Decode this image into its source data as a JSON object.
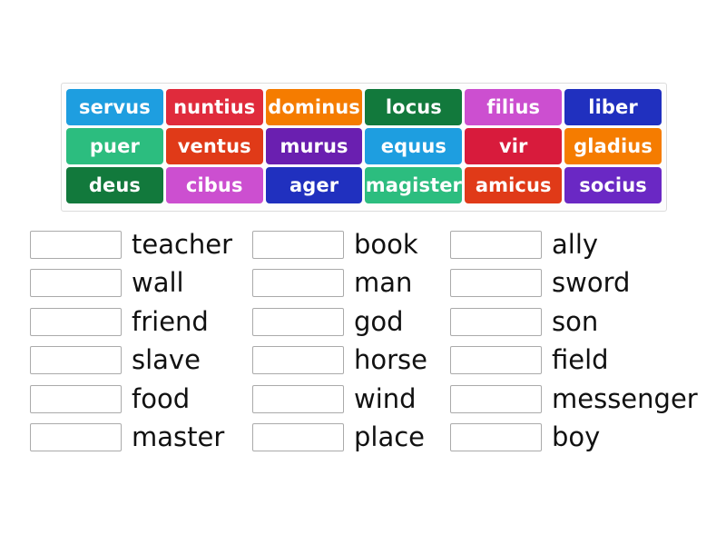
{
  "page": {
    "background_color": "#ffffff",
    "panel_border_color": "#dcdcdc",
    "panel_background_color": "#fdfdfd",
    "dropbox_border_color": "#aaaaaa",
    "label_text_color": "#111111"
  },
  "word_bank": {
    "rows": [
      [
        {
          "label": "servus",
          "color": "#1e9ee0"
        },
        {
          "label": "nuntius",
          "color": "#e02b3c"
        },
        {
          "label": "dominus",
          "color": "#f57c00"
        },
        {
          "label": "locus",
          "color": "#12793c"
        },
        {
          "label": "filius",
          "color": "#cc4fd0"
        },
        {
          "label": "liber",
          "color": "#2030bf"
        }
      ],
      [
        {
          "label": "puer",
          "color": "#2cbd7f"
        },
        {
          "label": "ventus",
          "color": "#e03a18"
        },
        {
          "label": "murus",
          "color": "#6a1fb0"
        },
        {
          "label": "equus",
          "color": "#1e9ee0"
        },
        {
          "label": "vir",
          "color": "#d81b3c"
        },
        {
          "label": "gladius",
          "color": "#f57c00"
        }
      ],
      [
        {
          "label": "deus",
          "color": "#12793c"
        },
        {
          "label": "cibus",
          "color": "#cc4fd0"
        },
        {
          "label": "ager",
          "color": "#2030bf"
        },
        {
          "label": "magister",
          "color": "#2cbd7f"
        },
        {
          "label": "amicus",
          "color": "#e03a18"
        },
        {
          "label": "socius",
          "color": "#6a28c4"
        }
      ]
    ]
  },
  "answers": {
    "columns": [
      {
        "rows": [
          {
            "value": "",
            "label": "teacher"
          },
          {
            "value": "",
            "label": "wall"
          },
          {
            "value": "",
            "label": "friend"
          },
          {
            "value": "",
            "label": "slave"
          },
          {
            "value": "",
            "label": "food"
          },
          {
            "value": "",
            "label": "master"
          }
        ]
      },
      {
        "rows": [
          {
            "value": "",
            "label": "book"
          },
          {
            "value": "",
            "label": "man"
          },
          {
            "value": "",
            "label": "god"
          },
          {
            "value": "",
            "label": "horse"
          },
          {
            "value": "",
            "label": "wind"
          },
          {
            "value": "",
            "label": "place"
          }
        ]
      },
      {
        "rows": [
          {
            "value": "",
            "label": "ally"
          },
          {
            "value": "",
            "label": "sword"
          },
          {
            "value": "",
            "label": "son"
          },
          {
            "value": "",
            "label": "field"
          },
          {
            "value": "",
            "label": "messenger"
          },
          {
            "value": "",
            "label": "boy"
          }
        ]
      }
    ]
  }
}
